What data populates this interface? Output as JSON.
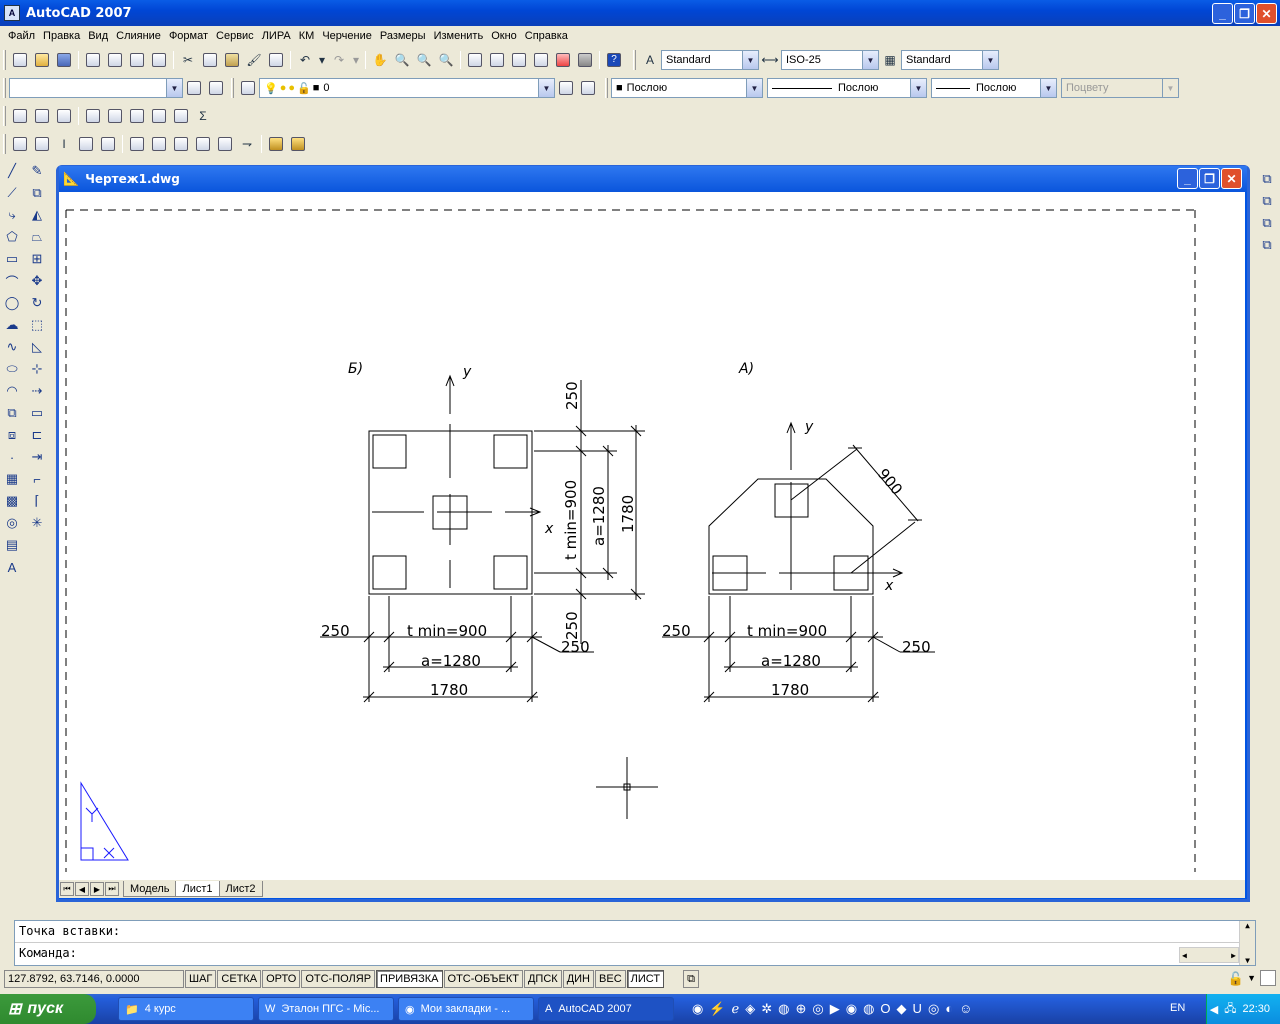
{
  "app": {
    "title": "AutoCAD 2007"
  },
  "menu": [
    "Файл",
    "Правка",
    "Вид",
    "Слияние",
    "Формат",
    "Сервис",
    "ЛИРА",
    "КМ",
    "Черчение",
    "Размеры",
    "Изменить",
    "Окно",
    "Справка"
  ],
  "toolbar": {
    "text_style": "Standard",
    "dim_style": "ISO-25",
    "table_style": "Standard",
    "layer": "0",
    "color": "Послою",
    "linetype": "Послою",
    "lineweight": "Послою",
    "plotstyle": "Поцвету"
  },
  "document": {
    "title": "Чертеж1.dwg"
  },
  "drawing": {
    "label_b": "Б)",
    "label_a": "А)",
    "axis_y": "y",
    "axis_x": "x",
    "dim_250": "250",
    "dim_t": "t  min=900",
    "dim_a": "a=1280",
    "dim_1780": "1780",
    "dim_900": "900",
    "dim_v_250": "250",
    "dim_v_t": "t  min=900",
    "dim_v_a": "a=1280",
    "dim_v_1780": "1780"
  },
  "tabs": [
    "Модель",
    "Лист1",
    "Лист2"
  ],
  "command": {
    "line1": "Точка вставки:",
    "line2": "Команда:"
  },
  "status": {
    "coords": "127.8792, 63.7146, 0.0000",
    "buttons": [
      "ШАГ",
      "СЕТКА",
      "ОРТО",
      "ОТС-ПОЛЯР",
      "ПРИВЯЗКА",
      "ОТС-ОБЪЕКТ",
      "ДПСК",
      "ДИН",
      "ВЕС",
      "ЛИСТ"
    ]
  },
  "taskbar": {
    "start": "пуск",
    "tasks": [
      "4 курс",
      "Эталон ПГС - Mic...",
      "Мои закладки - ...",
      "AutoCAD 2007"
    ],
    "lang": "EN",
    "time": "22:30"
  }
}
